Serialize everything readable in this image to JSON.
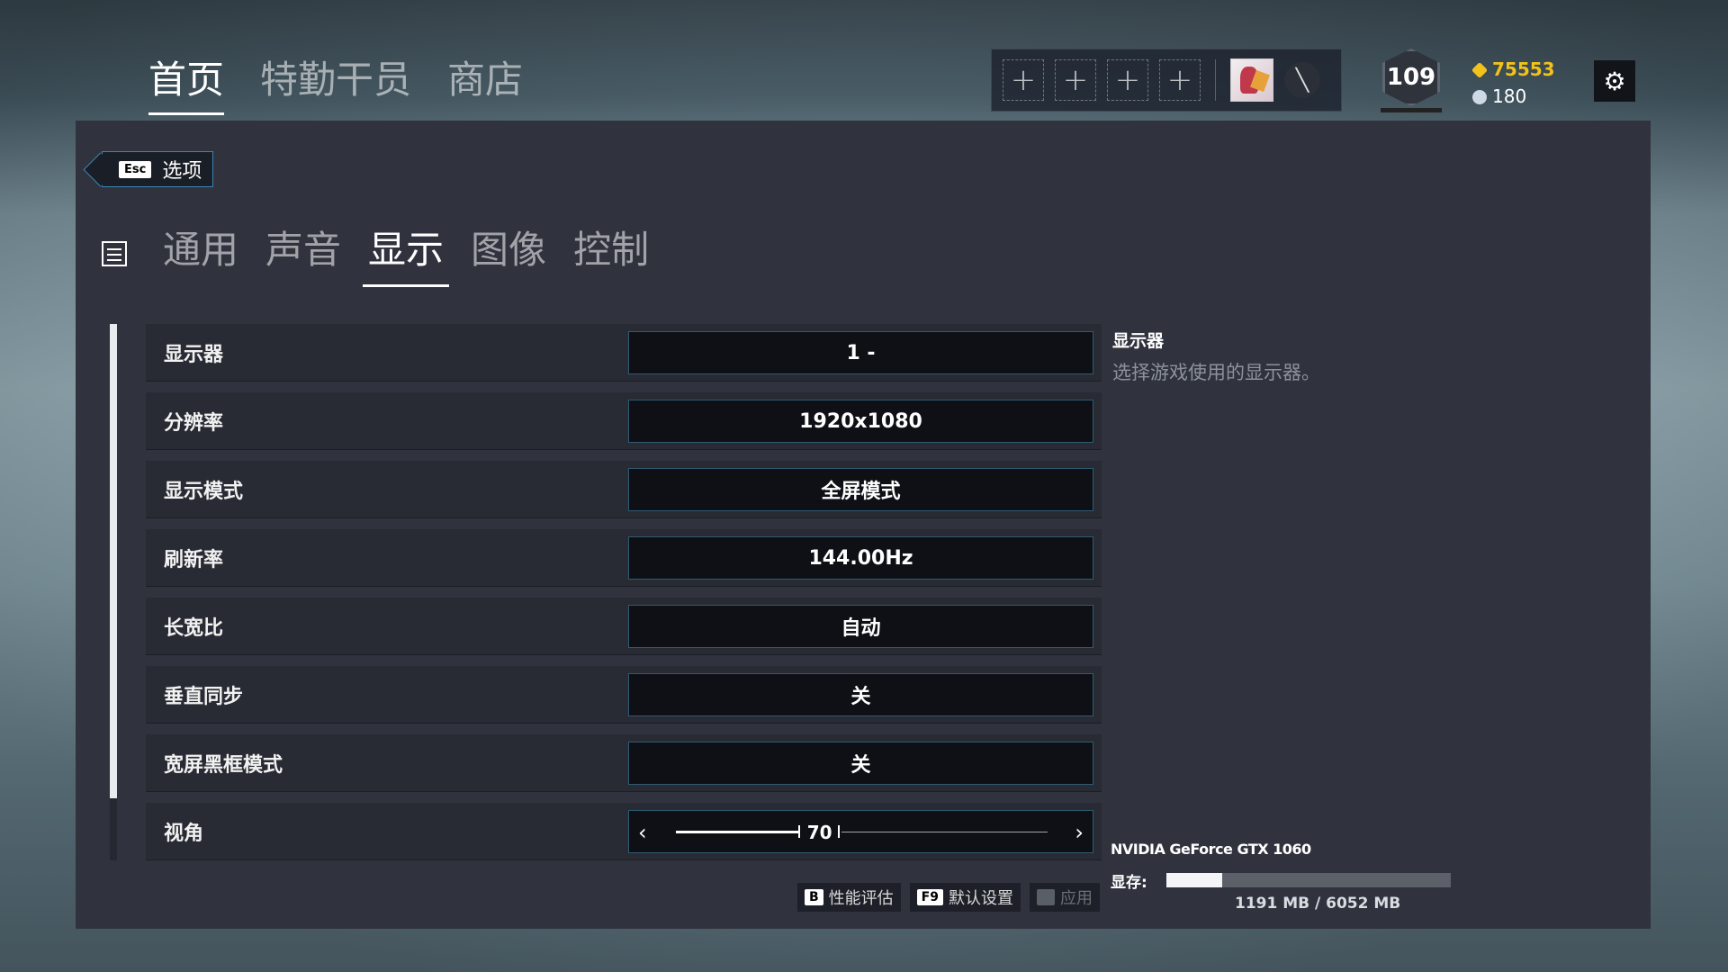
{
  "topnav": {
    "tabs": [
      {
        "label": "首页",
        "active": true
      },
      {
        "label": "特勤干员",
        "active": false
      },
      {
        "label": "商店",
        "active": false
      }
    ]
  },
  "squad": {
    "slot_glyph": "+",
    "emblem_glyph": "╲"
  },
  "profile": {
    "level": "109",
    "renown": "75553",
    "credits": "180"
  },
  "options": {
    "esc_key": "Esc",
    "title": "选项"
  },
  "subnav": {
    "tabs": [
      {
        "label": "通用"
      },
      {
        "label": "声音"
      },
      {
        "label": "显示",
        "active": true
      },
      {
        "label": "图像"
      },
      {
        "label": "控制"
      }
    ]
  },
  "settings": [
    {
      "label": "显示器",
      "value": "1 -"
    },
    {
      "label": "分辨率",
      "value": "1920x1080"
    },
    {
      "label": "显示模式",
      "value": "全屏模式"
    },
    {
      "label": "刷新率",
      "value": "144.00Hz"
    },
    {
      "label": "长宽比",
      "value": "自动"
    },
    {
      "label": "垂直同步",
      "value": "关"
    },
    {
      "label": "宽屏黑框模式",
      "value": "关"
    }
  ],
  "fov": {
    "label": "视角",
    "value": "70",
    "min": 60,
    "max": 90,
    "left_glyph": "‹",
    "right_glyph": "›"
  },
  "description": {
    "title": "显示器",
    "text": "选择游戏使用的显示器。"
  },
  "gpu": {
    "name": "NVIDIA GeForce GTX 1060",
    "vram_label": "显存:",
    "vram_used": 1191,
    "vram_total": 6052,
    "vram_text": "1191 MB / 6052 MB"
  },
  "footer": {
    "benchmark": {
      "key": "B",
      "label": "性能评估"
    },
    "defaults": {
      "key": "F9",
      "label": "默认设置"
    },
    "apply": {
      "key": "␣",
      "label": "应用"
    }
  },
  "colors": {
    "accent_border": "#2f5a72",
    "renown": "#f1c21b",
    "panel": "#30333e"
  }
}
